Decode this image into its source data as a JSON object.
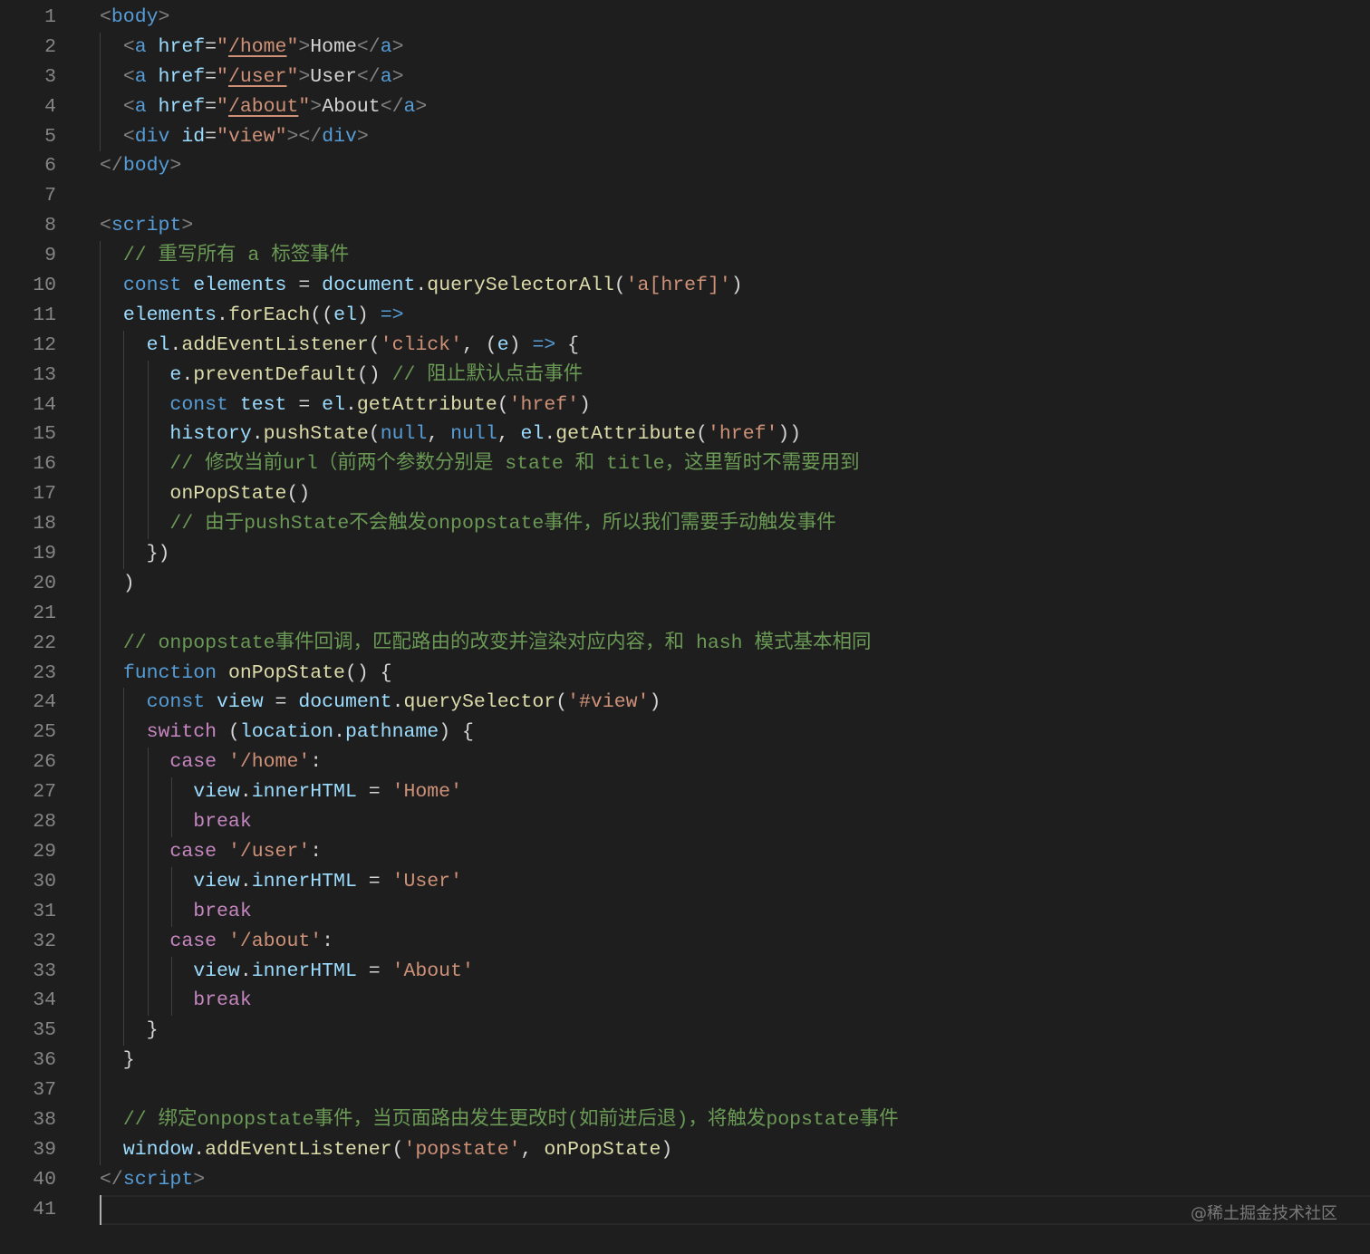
{
  "editor": {
    "current_line": 41,
    "lines": [
      [
        [
          "pu",
          "<"
        ],
        [
          "tg",
          "body"
        ],
        [
          "pu",
          ">"
        ]
      ],
      [
        [
          "tx",
          "  "
        ],
        [
          "pu",
          "<"
        ],
        [
          "tg",
          "a"
        ],
        [
          "tx",
          " "
        ],
        [
          "at",
          "href"
        ],
        [
          "tx",
          "="
        ],
        [
          "st",
          "\""
        ],
        [
          "su",
          "/home"
        ],
        [
          "st",
          "\""
        ],
        [
          "pu",
          ">"
        ],
        [
          "tx",
          "Home"
        ],
        [
          "pu",
          "</"
        ],
        [
          "tg",
          "a"
        ],
        [
          "pu",
          ">"
        ]
      ],
      [
        [
          "tx",
          "  "
        ],
        [
          "pu",
          "<"
        ],
        [
          "tg",
          "a"
        ],
        [
          "tx",
          " "
        ],
        [
          "at",
          "href"
        ],
        [
          "tx",
          "="
        ],
        [
          "st",
          "\""
        ],
        [
          "su",
          "/user"
        ],
        [
          "st",
          "\""
        ],
        [
          "pu",
          ">"
        ],
        [
          "tx",
          "User"
        ],
        [
          "pu",
          "</"
        ],
        [
          "tg",
          "a"
        ],
        [
          "pu",
          ">"
        ]
      ],
      [
        [
          "tx",
          "  "
        ],
        [
          "pu",
          "<"
        ],
        [
          "tg",
          "a"
        ],
        [
          "tx",
          " "
        ],
        [
          "at",
          "href"
        ],
        [
          "tx",
          "="
        ],
        [
          "st",
          "\""
        ],
        [
          "su",
          "/about"
        ],
        [
          "st",
          "\""
        ],
        [
          "pu",
          ">"
        ],
        [
          "tx",
          "About"
        ],
        [
          "pu",
          "</"
        ],
        [
          "tg",
          "a"
        ],
        [
          "pu",
          ">"
        ]
      ],
      [
        [
          "tx",
          "  "
        ],
        [
          "pu",
          "<"
        ],
        [
          "tg",
          "div"
        ],
        [
          "tx",
          " "
        ],
        [
          "at",
          "id"
        ],
        [
          "tx",
          "="
        ],
        [
          "st",
          "\"view\""
        ],
        [
          "pu",
          "></"
        ],
        [
          "tg",
          "div"
        ],
        [
          "pu",
          ">"
        ]
      ],
      [
        [
          "pu",
          "</"
        ],
        [
          "tg",
          "body"
        ],
        [
          "pu",
          ">"
        ]
      ],
      [],
      [
        [
          "pu",
          "<"
        ],
        [
          "tg",
          "script"
        ],
        [
          "pu",
          ">"
        ]
      ],
      [
        [
          "tx",
          "  "
        ],
        [
          "cm",
          "// 重写所有 a 标签事件"
        ]
      ],
      [
        [
          "tx",
          "  "
        ],
        [
          "kw",
          "const"
        ],
        [
          "tx",
          " "
        ],
        [
          "vr",
          "elements"
        ],
        [
          "tx",
          " = "
        ],
        [
          "vr",
          "document"
        ],
        [
          "tx",
          "."
        ],
        [
          "fn",
          "querySelectorAll"
        ],
        [
          "tx",
          "("
        ],
        [
          "st",
          "'a[href]'"
        ],
        [
          "tx",
          ")"
        ]
      ],
      [
        [
          "tx",
          "  "
        ],
        [
          "vr",
          "elements"
        ],
        [
          "tx",
          "."
        ],
        [
          "fn",
          "forEach"
        ],
        [
          "tx",
          "(("
        ],
        [
          "vr",
          "el"
        ],
        [
          "tx",
          ") "
        ],
        [
          "kw",
          "=>"
        ]
      ],
      [
        [
          "tx",
          "    "
        ],
        [
          "vr",
          "el"
        ],
        [
          "tx",
          "."
        ],
        [
          "fn",
          "addEventListener"
        ],
        [
          "tx",
          "("
        ],
        [
          "st",
          "'click'"
        ],
        [
          "tx",
          ", ("
        ],
        [
          "vr",
          "e"
        ],
        [
          "tx",
          ") "
        ],
        [
          "kw",
          "=>"
        ],
        [
          "tx",
          " {"
        ]
      ],
      [
        [
          "tx",
          "      "
        ],
        [
          "vr",
          "e"
        ],
        [
          "tx",
          "."
        ],
        [
          "fn",
          "preventDefault"
        ],
        [
          "tx",
          "() "
        ],
        [
          "cm",
          "// 阻止默认点击事件"
        ]
      ],
      [
        [
          "tx",
          "      "
        ],
        [
          "kw",
          "const"
        ],
        [
          "tx",
          " "
        ],
        [
          "vr",
          "test"
        ],
        [
          "tx",
          " = "
        ],
        [
          "vr",
          "el"
        ],
        [
          "tx",
          "."
        ],
        [
          "fn",
          "getAttribute"
        ],
        [
          "tx",
          "("
        ],
        [
          "st",
          "'href'"
        ],
        [
          "tx",
          ")"
        ]
      ],
      [
        [
          "tx",
          "      "
        ],
        [
          "vr",
          "history"
        ],
        [
          "tx",
          "."
        ],
        [
          "fn",
          "pushState"
        ],
        [
          "tx",
          "("
        ],
        [
          "kw",
          "null"
        ],
        [
          "tx",
          ", "
        ],
        [
          "kw",
          "null"
        ],
        [
          "tx",
          ", "
        ],
        [
          "vr",
          "el"
        ],
        [
          "tx",
          "."
        ],
        [
          "fn",
          "getAttribute"
        ],
        [
          "tx",
          "("
        ],
        [
          "st",
          "'href'"
        ],
        [
          "tx",
          "))"
        ]
      ],
      [
        [
          "tx",
          "      "
        ],
        [
          "cm",
          "// 修改当前url（前两个参数分别是 state 和 title，这里暂时不需要用到"
        ]
      ],
      [
        [
          "tx",
          "      "
        ],
        [
          "fn",
          "onPopState"
        ],
        [
          "tx",
          "()"
        ]
      ],
      [
        [
          "tx",
          "      "
        ],
        [
          "cm",
          "// 由于pushState不会触发onpopstate事件，所以我们需要手动触发事件"
        ]
      ],
      [
        [
          "tx",
          "    })"
        ]
      ],
      [
        [
          "tx",
          "  )"
        ]
      ],
      [],
      [
        [
          "tx",
          "  "
        ],
        [
          "cm",
          "// onpopstate事件回调，匹配路由的改变并渲染对应内容，和 hash 模式基本相同"
        ]
      ],
      [
        [
          "tx",
          "  "
        ],
        [
          "kw",
          "function"
        ],
        [
          "tx",
          " "
        ],
        [
          "fn",
          "onPopState"
        ],
        [
          "tx",
          "() {"
        ]
      ],
      [
        [
          "tx",
          "    "
        ],
        [
          "kw",
          "const"
        ],
        [
          "tx",
          " "
        ],
        [
          "vr",
          "view"
        ],
        [
          "tx",
          " = "
        ],
        [
          "vr",
          "document"
        ],
        [
          "tx",
          "."
        ],
        [
          "fn",
          "querySelector"
        ],
        [
          "tx",
          "("
        ],
        [
          "st",
          "'#view'"
        ],
        [
          "tx",
          ")"
        ]
      ],
      [
        [
          "tx",
          "    "
        ],
        [
          "ct",
          "switch"
        ],
        [
          "tx",
          " ("
        ],
        [
          "vr",
          "location"
        ],
        [
          "tx",
          "."
        ],
        [
          "vr",
          "pathname"
        ],
        [
          "tx",
          ") {"
        ]
      ],
      [
        [
          "tx",
          "      "
        ],
        [
          "ct",
          "case"
        ],
        [
          "tx",
          " "
        ],
        [
          "st",
          "'/home'"
        ],
        [
          "tx",
          ":"
        ]
      ],
      [
        [
          "tx",
          "        "
        ],
        [
          "vr",
          "view"
        ],
        [
          "tx",
          "."
        ],
        [
          "vr",
          "innerHTML"
        ],
        [
          "tx",
          " = "
        ],
        [
          "st",
          "'Home'"
        ]
      ],
      [
        [
          "tx",
          "        "
        ],
        [
          "ct",
          "break"
        ]
      ],
      [
        [
          "tx",
          "      "
        ],
        [
          "ct",
          "case"
        ],
        [
          "tx",
          " "
        ],
        [
          "st",
          "'/user'"
        ],
        [
          "tx",
          ":"
        ]
      ],
      [
        [
          "tx",
          "        "
        ],
        [
          "vr",
          "view"
        ],
        [
          "tx",
          "."
        ],
        [
          "vr",
          "innerHTML"
        ],
        [
          "tx",
          " = "
        ],
        [
          "st",
          "'User'"
        ]
      ],
      [
        [
          "tx",
          "        "
        ],
        [
          "ct",
          "break"
        ]
      ],
      [
        [
          "tx",
          "      "
        ],
        [
          "ct",
          "case"
        ],
        [
          "tx",
          " "
        ],
        [
          "st",
          "'/about'"
        ],
        [
          "tx",
          ":"
        ]
      ],
      [
        [
          "tx",
          "        "
        ],
        [
          "vr",
          "view"
        ],
        [
          "tx",
          "."
        ],
        [
          "vr",
          "innerHTML"
        ],
        [
          "tx",
          " = "
        ],
        [
          "st",
          "'About'"
        ]
      ],
      [
        [
          "tx",
          "        "
        ],
        [
          "ct",
          "break"
        ]
      ],
      [
        [
          "tx",
          "    }"
        ]
      ],
      [
        [
          "tx",
          "  }"
        ]
      ],
      [],
      [
        [
          "tx",
          "  "
        ],
        [
          "cm",
          "// 绑定onpopstate事件，当页面路由发生更改时(如前进后退)，将触发popstate事件"
        ]
      ],
      [
        [
          "tx",
          "  "
        ],
        [
          "vr",
          "window"
        ],
        [
          "tx",
          "."
        ],
        [
          "fn",
          "addEventListener"
        ],
        [
          "tx",
          "("
        ],
        [
          "st",
          "'popstate'"
        ],
        [
          "tx",
          ", "
        ],
        [
          "fn",
          "onPopState"
        ],
        [
          "tx",
          ")"
        ]
      ],
      [
        [
          "pu",
          "</"
        ],
        [
          "tg",
          "script"
        ],
        [
          "pu",
          ">"
        ]
      ],
      []
    ]
  },
  "watermark": "@稀土掘金技术社区"
}
